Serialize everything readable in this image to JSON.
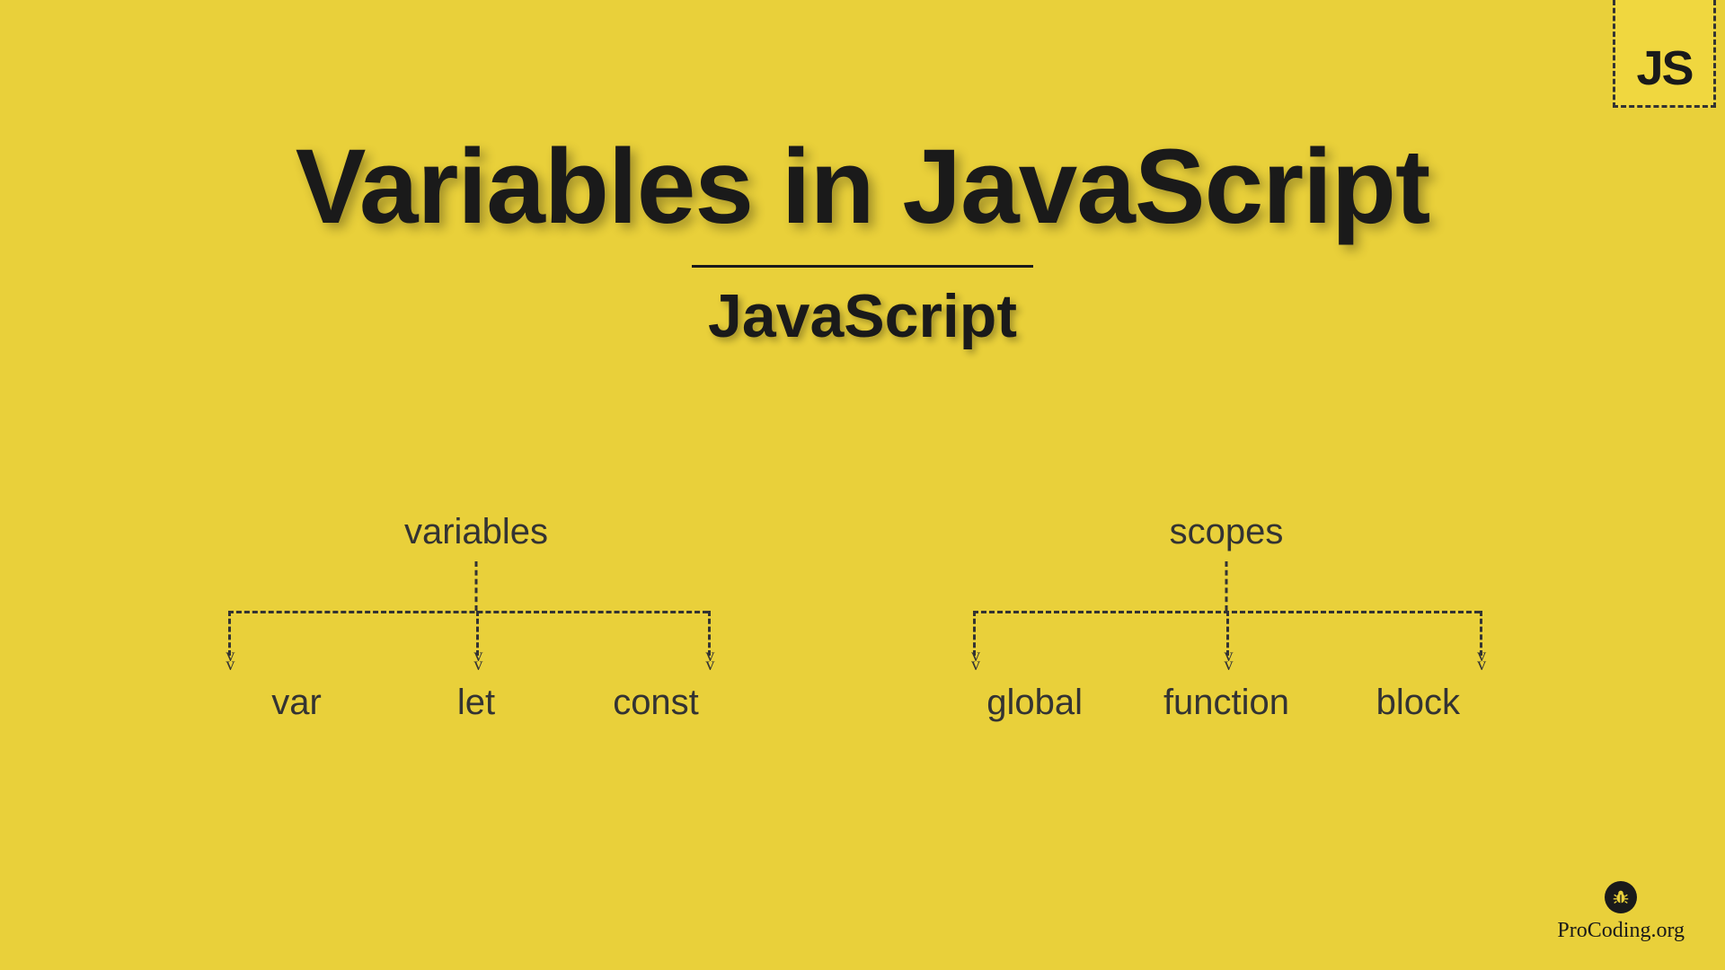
{
  "badge": {
    "text": "JS"
  },
  "title": "Variables in JavaScript",
  "subtitle": "JavaScript",
  "trees": {
    "left": {
      "root": "variables",
      "children": [
        "var",
        "let",
        "const"
      ]
    },
    "right": {
      "root": "scopes",
      "children": [
        "global",
        "function",
        "block"
      ]
    }
  },
  "attribution": "ProCoding.org"
}
